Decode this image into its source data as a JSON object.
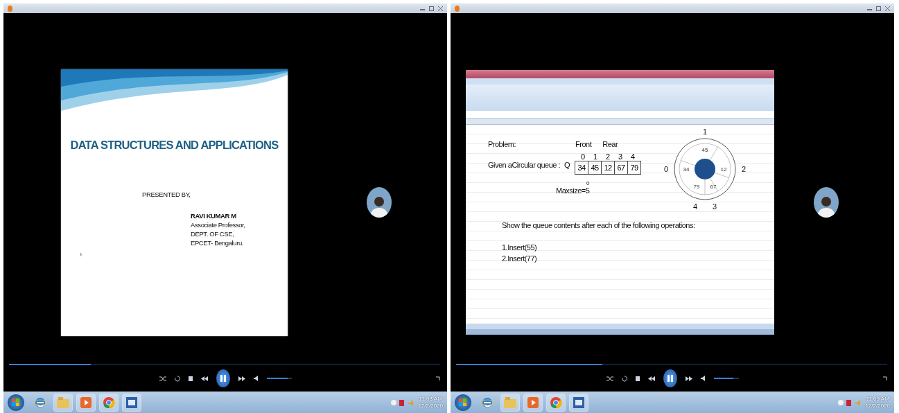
{
  "windows": [
    {
      "kind": "slide",
      "slide": {
        "title": "DATA STRUCTURES AND APPLICATIONS",
        "presented_by": "PRESENTED BY,",
        "presenter": "RAVI KUMAR M",
        "presenter_lines": [
          "Associate Professor,",
          "DEPT. OF CSE,",
          "EPCET- Bengaluru."
        ]
      },
      "progress": {
        "level": 0.19
      },
      "volume": {
        "level": 0.85
      },
      "taskbar": {
        "time": "11:08 AM",
        "date": "12/2/2020"
      }
    },
    {
      "kind": "spreadsheet",
      "sheet": {
        "problem_label": "Problem:",
        "front_label": "Front",
        "rear_label": "Rear",
        "indices": [
          "0",
          "1",
          "2",
          "3",
          "4"
        ],
        "queue_label": "Given aCircular queue :",
        "queue_name": "Q",
        "cells": [
          "34",
          "45",
          "12",
          "67",
          "79"
        ],
        "marker": "0",
        "maxsize": "Maxsize=5",
        "ring": {
          "slots": [
            {
              "index": "1",
              "value": "45"
            },
            {
              "index": "0",
              "value": "34"
            },
            {
              "index": "2",
              "value": "12"
            },
            {
              "index": "4",
              "value": "79"
            },
            {
              "index": "3",
              "value": "67"
            }
          ]
        },
        "instruction": "Show the queue contents after each of the following operations:",
        "operations": [
          "1.Insert(55)",
          "2.Insert(77)"
        ]
      },
      "progress": {
        "level": 0.34
      },
      "volume": {
        "level": 0.8
      },
      "taskbar": {
        "time": "11:09 AM",
        "date": "12/2/2020"
      }
    }
  ]
}
